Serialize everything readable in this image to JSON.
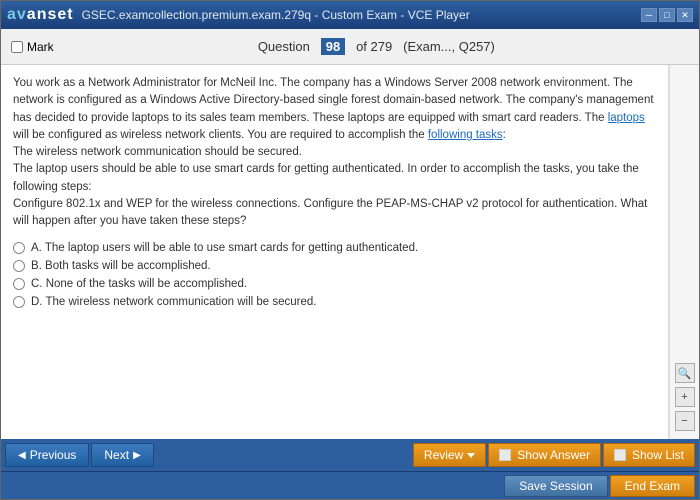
{
  "window": {
    "title": "GSEC.examcollection.premium.exam.279q - Custom Exam - VCE Player",
    "controls": [
      "minimize",
      "maximize",
      "close"
    ]
  },
  "logo": {
    "text": "avanset",
    "prefix": "av",
    "suffix": "anset"
  },
  "header": {
    "mark_label": "Mark",
    "question_label": "Question",
    "question_number": "98",
    "question_total": "of 279",
    "exam_info": "(Exam..., Q257)"
  },
  "question": {
    "body": "You work as a Network Administrator for McNeil Inc. The company has a Windows Server 2008 network environment. The network is configured as a Windows Active Directory-based single forest domain-based network. The company's management has decided to provide laptops to its sales team members. These laptops are equipped with smart card readers. The laptops will be configured as wireless network clients. You are required to accomplish the following tasks:\nThe wireless network communication should be secured.\nThe laptop users should be able to use smart cards for getting authenticated. In order to accomplish the tasks, you take the following steps:\nConfigure 802.1x and WEP for the wireless connections. Configure the PEAP-MS-CHAP v2 protocol for authentication. What will happen after you have taken these steps?",
    "options": [
      {
        "letter": "A",
        "text": "The laptop users will be able to use smart cards for getting authenticated."
      },
      {
        "letter": "B",
        "text": "Both tasks will be accomplished."
      },
      {
        "letter": "C",
        "text": "None of the tasks will be accomplished."
      },
      {
        "letter": "D",
        "text": "The wireless network communication will be secured."
      }
    ]
  },
  "sidebar": {
    "icons": [
      "search",
      "plus",
      "minus"
    ]
  },
  "toolbar": {
    "previous_label": "Previous",
    "next_label": "Next",
    "review_label": "Review",
    "show_answer_label": "Show Answer",
    "show_list_label": "Show List",
    "save_session_label": "Save Session",
    "end_exam_label": "End Exam"
  }
}
